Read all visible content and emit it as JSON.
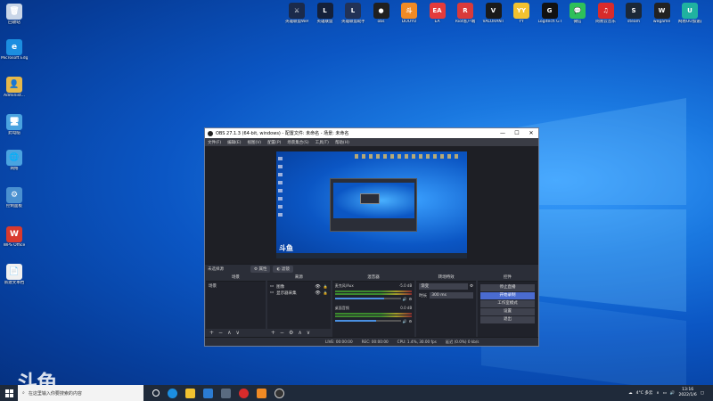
{
  "desktop_left": [
    {
      "label": "回收站",
      "color": "#c9d6e8",
      "glyph": "🗑"
    },
    {
      "label": "Microsoft Edge",
      "color": "#1c8ee0",
      "glyph": "e"
    },
    {
      "label": "Administ...",
      "color": "#e6b84a",
      "glyph": "👤"
    },
    {
      "label": "此电脑",
      "color": "#4aa3e0",
      "glyph": "🖥"
    },
    {
      "label": "网络",
      "color": "#4aa3e0",
      "glyph": "🌐"
    },
    {
      "label": "控制面板",
      "color": "#4a90d0",
      "glyph": "⚙"
    },
    {
      "label": "WPS Office",
      "color": "#d83a2e",
      "glyph": "W"
    },
    {
      "label": "新建文本档",
      "color": "#f0f0f0",
      "glyph": "📄"
    }
  ],
  "desktop_top": [
    {
      "label": "英雄联盟WeGame版",
      "color": "#1b2a4a",
      "glyph": "⚔"
    },
    {
      "label": "英雄联盟",
      "color": "#14203a",
      "glyph": "L"
    },
    {
      "label": "英雄联盟助手",
      "color": "#223256",
      "glyph": "L"
    },
    {
      "label": "obs",
      "color": "#202020",
      "glyph": "●"
    },
    {
      "label": "DOUYU",
      "color": "#f08a24",
      "glyph": "斗"
    },
    {
      "label": "EA",
      "color": "#e43b3b",
      "glyph": "EA"
    },
    {
      "label": "Riot客户端",
      "color": "#d93a3a",
      "glyph": "R"
    },
    {
      "label": "VALORANT",
      "color": "#1a1a1a",
      "glyph": "V"
    },
    {
      "label": "YY",
      "color": "#f2c230",
      "glyph": "YY"
    },
    {
      "label": "Logitech G HUB",
      "color": "#111",
      "glyph": "G"
    },
    {
      "label": "微信",
      "color": "#2ec05a",
      "glyph": "💬"
    },
    {
      "label": "网易云音乐",
      "color": "#d82b2b",
      "glyph": "♫"
    },
    {
      "label": "steam",
      "color": "#1b2838",
      "glyph": "S"
    },
    {
      "label": "wegame",
      "color": "#222",
      "glyph": "W"
    },
    {
      "label": "网易UU加速器",
      "color": "#20b2a0",
      "glyph": "U"
    }
  ],
  "obs": {
    "title": "OBS 27.1.3 (64-bit, windows) - 配置文件: 未命名 - 场景: 未命名",
    "menu": [
      "文件(F)",
      "编辑(E)",
      "视图(V)",
      "配置(P)",
      "场景集合(S)",
      "工具(T)",
      "帮助(H)"
    ],
    "scene_bar_label": "未选择源",
    "scene_bar_btn1": "⚙ 属性",
    "scene_bar_btn2": "◐ 滤镜",
    "docks": {
      "scenes": {
        "title": "场景",
        "items": [
          "场景"
        ]
      },
      "sources": {
        "title": "来源",
        "items": [
          "图像",
          "显示器采集"
        ]
      },
      "mixer": {
        "title": "混音器",
        "channels": [
          {
            "name": "麦克风/Aux",
            "db": "-5.0 dB",
            "level": 0.75
          },
          {
            "name": "桌面音频",
            "db": "0.0 dB",
            "level": 0.62
          }
        ]
      },
      "transitions": {
        "title": "转场特效",
        "type": "渐变",
        "duration_label": "时长",
        "duration": "300 ms"
      },
      "controls": {
        "title": "控件",
        "buttons": [
          "停止直播",
          "开始录制",
          "工作室模式",
          "设置",
          "退出"
        ]
      }
    },
    "status": {
      "live": "LIVE: 00:00:00",
      "rec": "REC: 00:00:00",
      "cpu": "CPU: 1.4%, 30.00 fps",
      "kbps": "延迟 (0.0%)  0 kb/s"
    }
  },
  "taskbar": {
    "search_placeholder": "在这里输入你要搜索的内容",
    "weather": "4°C 多云",
    "time": "13:16",
    "date": "2022/1/6"
  },
  "watermark": "斗鱼"
}
